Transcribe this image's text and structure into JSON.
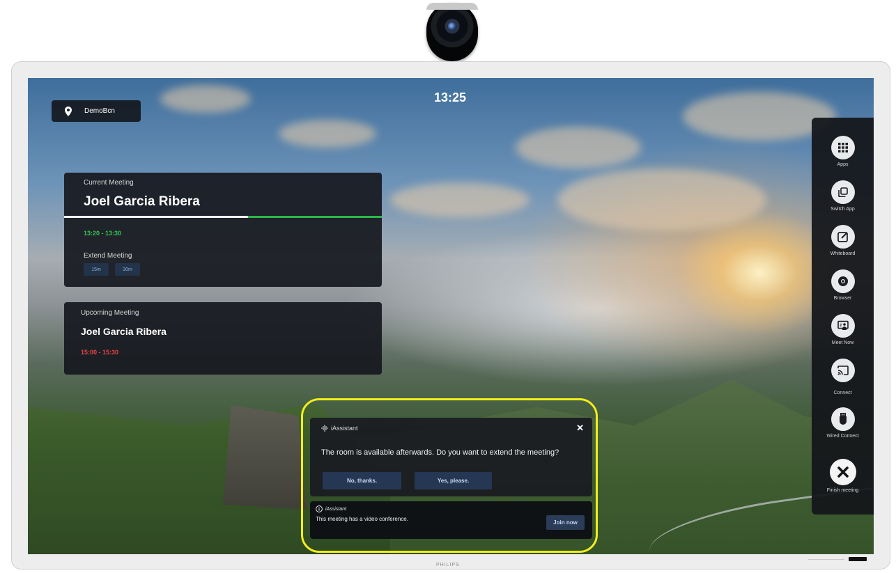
{
  "clock": "13:25",
  "location": {
    "label": "DemoBcn",
    "icon": "location-pin-icon"
  },
  "current_meeting": {
    "caption": "Current Meeting",
    "organizer": "Joel Garcia Ribera",
    "time": "13:20 - 13:30",
    "progress": 0.58,
    "extend_label": "Extend Meeting",
    "extend_options": [
      "15m",
      "30m"
    ]
  },
  "upcoming_meeting": {
    "caption": "Upcoming Meeting",
    "organizer": "Joel Garcia Ribera",
    "time": "15:00 - 15:30"
  },
  "sidebar": {
    "items": [
      {
        "label": "Apps",
        "icon": "apps-grid-icon"
      },
      {
        "label": "Switch App",
        "icon": "switch-app-icon"
      },
      {
        "label": "Whiteboard",
        "icon": "whiteboard-icon"
      },
      {
        "label": "Browser",
        "icon": "browser-icon"
      },
      {
        "label": "Meet Now",
        "icon": "meet-now-icon"
      },
      {
        "label": "Connect",
        "icon": "cast-icon"
      },
      {
        "label": "Wired Connect",
        "icon": "usb-icon"
      },
      {
        "label": "Finish meeting",
        "icon": "close-icon"
      }
    ]
  },
  "assistant": {
    "brand": "iAssistant",
    "message": "The room is available afterwards. Do you want to extend the meeting?",
    "decline_label": "No, thanks.",
    "accept_label": "Yes, please."
  },
  "notification": {
    "source": "iAssistant",
    "text": "This meeting has a video conference.",
    "join_label": "Join now"
  },
  "device": {
    "brand": "PHILIPS"
  },
  "colors": {
    "accent_green": "#2cb84a",
    "time_green": "#35c553",
    "time_red": "#e8444a",
    "highlight": "#f2ee1a",
    "button": "#253752"
  }
}
